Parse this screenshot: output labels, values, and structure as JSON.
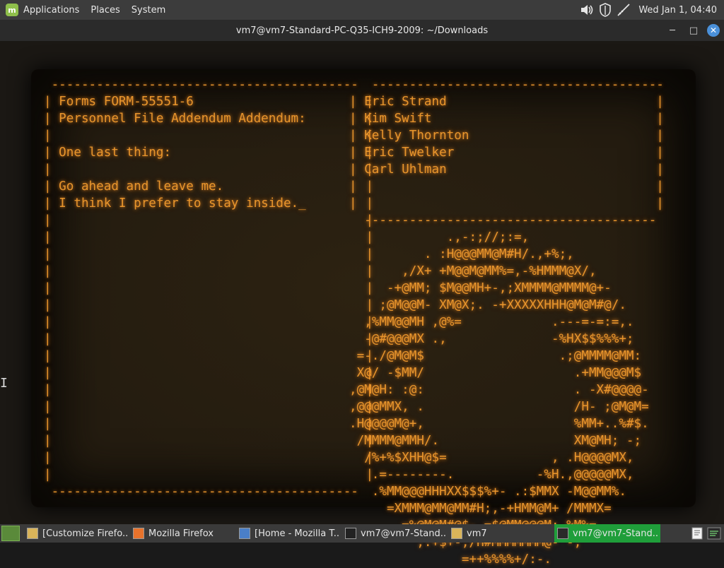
{
  "top_panel": {
    "menus": [
      "Applications",
      "Places",
      "System"
    ],
    "clock": "Wed Jan  1, 04:40",
    "tray_icons": [
      "volume-icon",
      "shield-icon",
      "network-icon"
    ]
  },
  "window": {
    "title": "vm7@vm7-Standard-PC-Q35-ICH9-2009: ~/Downloads",
    "controls": {
      "minimize": "─",
      "maximize": "□",
      "close": "✕"
    }
  },
  "terminal": {
    "left_lines": [
      " ----------------------------------------- ",
      "| Forms FORM-55551-6                       |",
      "| Personnel File Addendum Addendum:        |",
      "|                                          |",
      "| One last thing:                          |",
      "|                                          |",
      "| Go ahead and leave me.                   |",
      "| I think I prefer to stay inside._        |",
      "|                                          |",
      "|                                          |",
      "|                                          |",
      "|                                          |",
      "|                                          |",
      "|                                          |",
      "|                                          |",
      "|                                          |",
      "|                                          |",
      "|                                          |",
      "|                                          |",
      "|                                          |",
      "|                                          |",
      "|                                          |",
      "|                                          |",
      "|                                          |",
      " ----------------------------------------- "
    ],
    "right_lines": [
      "   --------------------------------------- ",
      "| Eric Strand                            |",
      "| Kim Swift                              |",
      "| Kelly Thornton                         |",
      "| Eric Twelker                           |",
      "| Carl Uhlman                            |",
      "|                                        |",
      "|                                        |",
      "  --------------------------------------- ",
      "             .,-:;//;:=,",
      "          . :H@@@MM@M#H/.,+%;,",
      "       ,/X+ +M@@M@MM%=,-%HMMM@X/,",
      "     -+@MM; $M@@MH+-,;XMMMM@MMMM@+-",
      "    ;@M@@M- XM@X;. -+XXXXXHHH@M@M#@/.",
      "  ,%MM@@MH ,@%=            .---=-=:=,.",
      "  -@#@@@MX .,              -%HX$$%%%+;",
      " =-./@M@M$                  .;@MMMM@MM:",
      " X@/ -$MM/                    .+MM@@@M$",
      ",@M@H: :@:                    . -X#@@@@-",
      ",@@@MMX, .                    /H- ;@M@M=",
      ".H@@@@M@+,                    %MM+..%#$.",
      " /MMMM@MMH/.                  XM@MH; -;",
      "  /%+%$XHH@$=              , .H@@@@MX,",
      "   .=--------.           -%H.,@@@@@MX,",
      "   .%MM@@@HHHXX$$$%+- .:$MMX -M@@MM%.",
      "     =XMMM@MM@MM#H;,-+HMM@M+ /MMMX=",
      "       =%@M@M#@$-.=$@MM@@@M; %M%=",
      "         ,:+$+-,/H#MMMMMMM@- -,",
      "               =++%%%%+/:-."
    ],
    "cursor_glyph": "I"
  },
  "taskbar": {
    "tasks": [
      {
        "label": "[Customize Firefo...",
        "icon": "folder-icon",
        "active": false
      },
      {
        "label": "Mozilla Firefox",
        "icon": "firefox-icon",
        "active": false
      },
      {
        "label": "[Home - Mozilla T...",
        "icon": "thunderbird-icon",
        "active": false
      },
      {
        "label": "vm7@vm7-Stand...",
        "icon": "terminal-icon",
        "active": false
      },
      {
        "label": "vm7",
        "icon": "folder-icon",
        "active": false
      },
      {
        "label": "vm7@vm7-Stand...",
        "icon": "cmatrix-icon",
        "active": true
      }
    ]
  },
  "colors": {
    "terminal_text": "#e8952c",
    "panel_bg": "#3c3c3c",
    "active_task": "#1f9e3a",
    "mint_green": "#8fbf4b"
  }
}
